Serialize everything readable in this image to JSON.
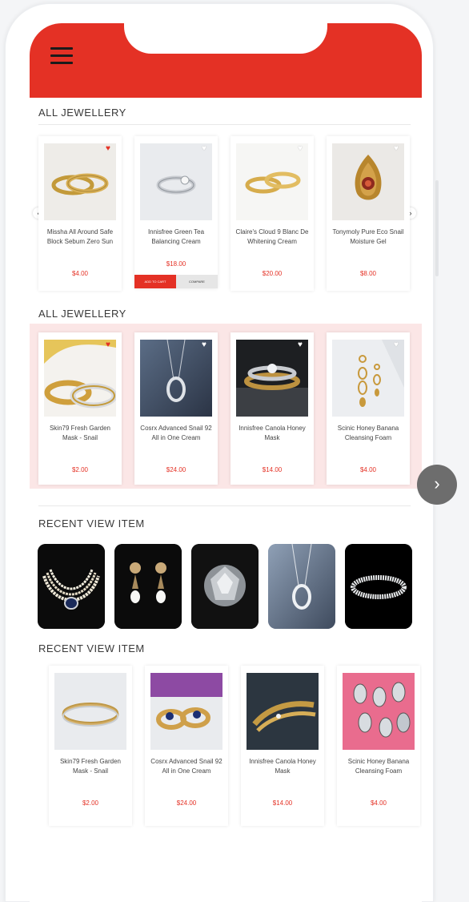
{
  "colors": {
    "brand": "#e43125",
    "price": "#e43125",
    "heart_active": "#e43125"
  },
  "header": {
    "menu_icon": "hamburger-icon"
  },
  "sections": [
    {
      "title": "ALL JEWELLERY",
      "products": [
        {
          "name": "Missha All Around Safe Block Sebum Zero Sun",
          "price": "$4.00",
          "favorite": true
        },
        {
          "name": "Innisfree Green Tea Balancing Cream",
          "price": "$18.00",
          "favorite": false,
          "add_to_cart": "ADD TO CART",
          "compare": "COMPARE"
        },
        {
          "name": "Claire's Cloud 9 Blanc De Whitening Cream",
          "price": "$20.00",
          "favorite": false
        },
        {
          "name": "Tonymoly Pure Eco Snail Moisture Gel",
          "price": "$8.00",
          "favorite": false
        }
      ]
    },
    {
      "title": "ALL JEWELLERY",
      "products": [
        {
          "name": "Skin79 Fresh Garden Mask - Snail",
          "price": "$2.00",
          "favorite": true
        },
        {
          "name": "Cosrx Advanced Snail 92 All in One Cream",
          "price": "$24.00",
          "favorite": false
        },
        {
          "name": "Innisfree Canola Honey Mask",
          "price": "$14.00",
          "favorite": false
        },
        {
          "name": "Scinic Honey Banana Cleansing Foam",
          "price": "$4.00",
          "favorite": false
        }
      ]
    },
    {
      "title": "RECENT VIEW ITEM",
      "items": [
        "pearl-necklace",
        "pearl-drop-earrings",
        "round-diamond",
        "silver-pendant",
        "diamond-tennis-bracelet"
      ]
    },
    {
      "title": "RECENT VIEW ITEM",
      "products": [
        {
          "name": "Skin79 Fresh Garden Mask - Snail",
          "price": "$2.00"
        },
        {
          "name": "Cosrx Advanced Snail 92 All in One Cream",
          "price": "$24.00"
        },
        {
          "name": "Innisfree Canola Honey Mask",
          "price": "$14.00"
        },
        {
          "name": "Scinic Honey Banana Cleansing Foam",
          "price": "$4.00"
        }
      ]
    }
  ],
  "nav": {
    "prev": "‹",
    "next": "›"
  }
}
